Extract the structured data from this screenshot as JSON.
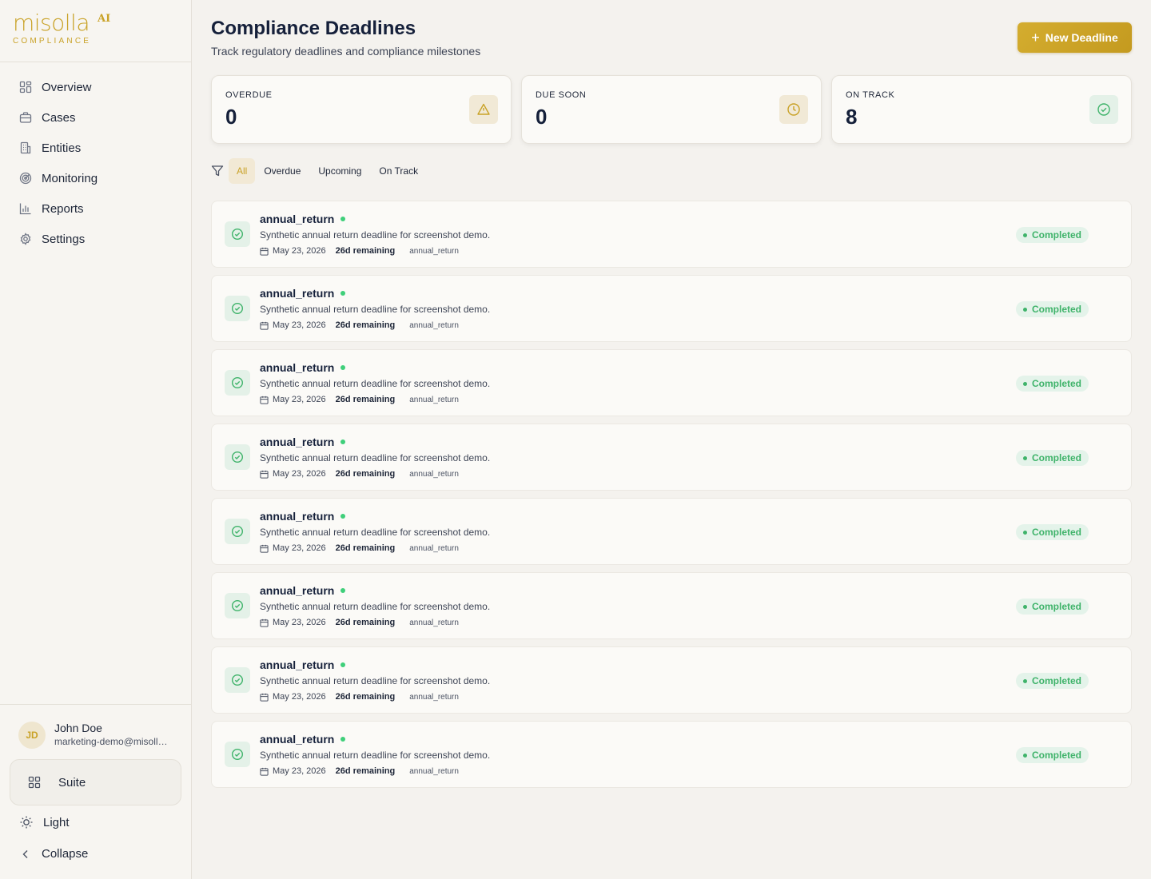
{
  "brand": {
    "name": "misolla",
    "superscript": "AI",
    "subtitle": "COMPLIANCE",
    "accent": "#c9a227"
  },
  "sidebar": {
    "items": [
      {
        "label": "Overview",
        "icon": "grid-icon"
      },
      {
        "label": "Cases",
        "icon": "briefcase-icon"
      },
      {
        "label": "Entities",
        "icon": "building-icon"
      },
      {
        "label": "Monitoring",
        "icon": "radar-icon"
      },
      {
        "label": "Reports",
        "icon": "bar-chart-icon"
      },
      {
        "label": "Settings",
        "icon": "gear-icon"
      }
    ],
    "user": {
      "initials": "JD",
      "name": "John Doe",
      "email": "marketing-demo@misolla.ai"
    },
    "suite_label": "Suite",
    "theme_label": "Light",
    "collapse_label": "Collapse"
  },
  "header": {
    "title": "Compliance Deadlines",
    "subtitle": "Track regulatory deadlines and compliance milestones",
    "new_button": "New Deadline"
  },
  "stats": [
    {
      "label": "OVERDUE",
      "value": "0",
      "icon": "warning-icon"
    },
    {
      "label": "DUE SOON",
      "value": "0",
      "icon": "clock-icon"
    },
    {
      "label": "ON TRACK",
      "value": "8",
      "icon": "check-circle-icon"
    }
  ],
  "filters": {
    "tabs": [
      "All",
      "Overdue",
      "Upcoming",
      "On Track"
    ],
    "active": "All"
  },
  "deadlines": [
    {
      "title": "annual_return",
      "description": "Synthetic annual return deadline for screenshot demo.",
      "date": "May 23, 2026",
      "remaining": "26d remaining",
      "type": "annual_return",
      "status": "Completed"
    },
    {
      "title": "annual_return",
      "description": "Synthetic annual return deadline for screenshot demo.",
      "date": "May 23, 2026",
      "remaining": "26d remaining",
      "type": "annual_return",
      "status": "Completed"
    },
    {
      "title": "annual_return",
      "description": "Synthetic annual return deadline for screenshot demo.",
      "date": "May 23, 2026",
      "remaining": "26d remaining",
      "type": "annual_return",
      "status": "Completed"
    },
    {
      "title": "annual_return",
      "description": "Synthetic annual return deadline for screenshot demo.",
      "date": "May 23, 2026",
      "remaining": "26d remaining",
      "type": "annual_return",
      "status": "Completed"
    },
    {
      "title": "annual_return",
      "description": "Synthetic annual return deadline for screenshot demo.",
      "date": "May 23, 2026",
      "remaining": "26d remaining",
      "type": "annual_return",
      "status": "Completed"
    },
    {
      "title": "annual_return",
      "description": "Synthetic annual return deadline for screenshot demo.",
      "date": "May 23, 2026",
      "remaining": "26d remaining",
      "type": "annual_return",
      "status": "Completed"
    },
    {
      "title": "annual_return",
      "description": "Synthetic annual return deadline for screenshot demo.",
      "date": "May 23, 2026",
      "remaining": "26d remaining",
      "type": "annual_return",
      "status": "Completed"
    },
    {
      "title": "annual_return",
      "description": "Synthetic annual return deadline for screenshot demo.",
      "date": "May 23, 2026",
      "remaining": "26d remaining",
      "type": "annual_return",
      "status": "Completed"
    }
  ],
  "colors": {
    "success": "#3fb36a",
    "gold": "#c9a227",
    "text": "#15203a"
  }
}
